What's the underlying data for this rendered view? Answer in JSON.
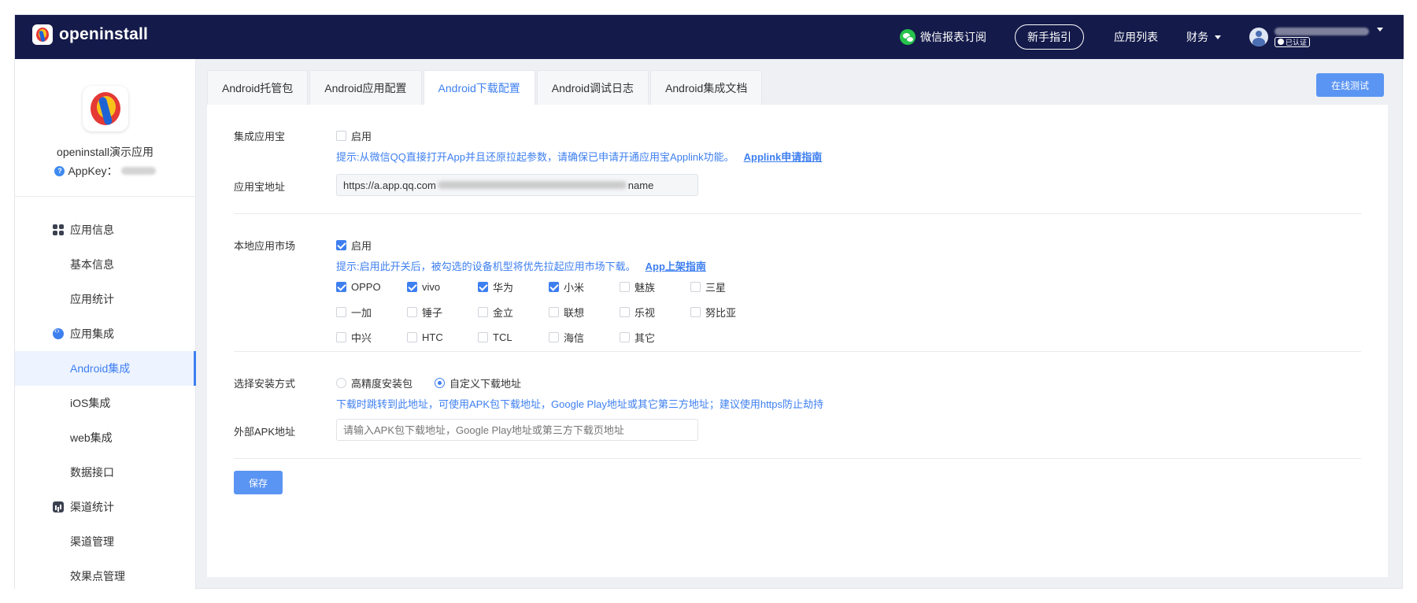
{
  "topbar": {
    "logo_text": "openinstall",
    "wechat_label": "微信报表订阅",
    "guide_label": "新手指引",
    "app_list_label": "应用列表",
    "finance_label": "财务",
    "verified_label": "已认证"
  },
  "sidebar": {
    "app_name": "openinstall演示应用",
    "appkey_label": "AppKey：",
    "groups": [
      {
        "label": "应用信息",
        "icon": "grid-icon",
        "items": [
          "基本信息",
          "应用统计"
        ]
      },
      {
        "label": "应用集成",
        "icon": "integration-icon",
        "items": [
          "Android集成",
          "iOS集成",
          "web集成",
          "数据接口"
        ],
        "active": "Android集成"
      },
      {
        "label": "渠道统计",
        "icon": "stats-icon",
        "items": [
          "渠道管理",
          "效果点管理"
        ]
      }
    ]
  },
  "tabs": [
    {
      "label": "Android托管包",
      "active": false
    },
    {
      "label": "Android应用配置",
      "active": false
    },
    {
      "label": "Android下载配置",
      "active": true
    },
    {
      "label": "Android调试日志",
      "active": false
    },
    {
      "label": "Android集成文档",
      "active": false
    }
  ],
  "test_button_label": "在线测试",
  "yyb": {
    "label": "集成应用宝",
    "enable_label": "启用",
    "enabled": false,
    "hint": "提示:从微信QQ直接打开App并且还原拉起参数，请确保已申请开通应用宝Applink功能。",
    "hint_link": "Applink申请指南",
    "url_label": "应用宝地址",
    "url_prefix": "https://a.app.qq.com",
    "url_suffix": "name"
  },
  "market": {
    "label": "本地应用市场",
    "enable_label": "启用",
    "enabled": true,
    "hint": "提示:启用此开关后，被勾选的设备机型将优先拉起应用市场下载。",
    "hint_link": "App上架指南",
    "brands": [
      {
        "name": "OPPO",
        "checked": true
      },
      {
        "name": "vivo",
        "checked": true
      },
      {
        "name": "华为",
        "checked": true
      },
      {
        "name": "小米",
        "checked": true
      },
      {
        "name": "魅族",
        "checked": false
      },
      {
        "name": "三星",
        "checked": false
      },
      {
        "name": "一加",
        "checked": false
      },
      {
        "name": "锤子",
        "checked": false
      },
      {
        "name": "金立",
        "checked": false
      },
      {
        "name": "联想",
        "checked": false
      },
      {
        "name": "乐视",
        "checked": false
      },
      {
        "name": "努比亚",
        "checked": false
      },
      {
        "name": "中兴",
        "checked": false
      },
      {
        "name": "HTC",
        "checked": false
      },
      {
        "name": "TCL",
        "checked": false
      },
      {
        "name": "海信",
        "checked": false
      },
      {
        "name": "其它",
        "checked": false
      }
    ]
  },
  "install": {
    "label": "选择安装方式",
    "options": [
      {
        "label": "高精度安装包",
        "selected": false
      },
      {
        "label": "自定义下载地址",
        "selected": true
      }
    ],
    "hint": "下载时跳转到此地址，可使用APK包下载地址，Google Play地址或其它第三方地址；建议使用https防止劫持",
    "apk_label": "外部APK地址",
    "apk_placeholder": "请输入APK包下载地址，Google Play地址或第三方下载页地址",
    "apk_value": ""
  },
  "save_label": "保存",
  "colors": {
    "topbar": "#141a4a",
    "accent": "#3e7ff0",
    "button": "#5b95f3"
  }
}
